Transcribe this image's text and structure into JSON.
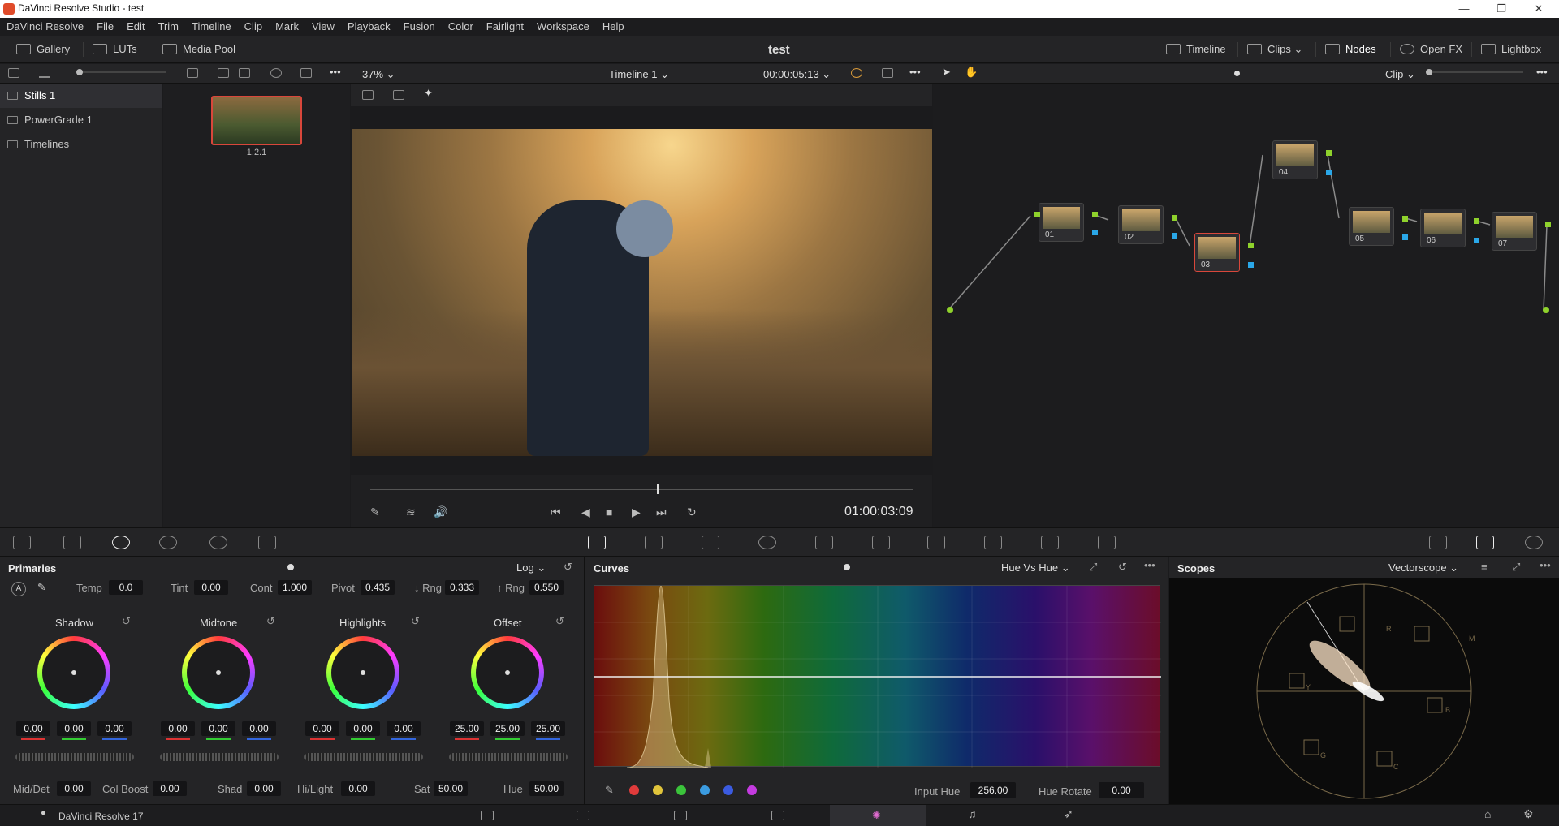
{
  "window": {
    "title": "DaVinci Resolve Studio - test"
  },
  "menu": [
    "DaVinci Resolve",
    "File",
    "Edit",
    "Trim",
    "Timeline",
    "Clip",
    "Mark",
    "View",
    "Playback",
    "Fusion",
    "Color",
    "Fairlight",
    "Workspace",
    "Help"
  ],
  "toolbar": {
    "gallery": "Gallery",
    "luts": "LUTs",
    "media_pool": "Media Pool",
    "project": "test",
    "timeline": "Timeline",
    "clips": "Clips",
    "nodes": "Nodes",
    "open_fx": "Open FX",
    "lightbox": "Lightbox"
  },
  "viewer": {
    "zoom": "37%",
    "timeline_name": "Timeline 1",
    "timecode_top": "00:00:05:13",
    "timecode_bottom": "01:00:03:09"
  },
  "node_bar": {
    "clip": "Clip"
  },
  "albums": [
    "Stills 1",
    "PowerGrade 1",
    "Timelines"
  ],
  "still": {
    "label": "1.2.1"
  },
  "nodes": [
    "01",
    "02",
    "03",
    "04",
    "05",
    "06",
    "07"
  ],
  "primaries": {
    "title": "Primaries",
    "mode": "Log",
    "fields": [
      {
        "label": "Temp",
        "value": "0.0"
      },
      {
        "label": "Tint",
        "value": "0.00"
      },
      {
        "label": "Cont",
        "value": "1.000"
      },
      {
        "label": "Pivot",
        "value": "0.435"
      },
      {
        "label": "↓ Rng",
        "value": "0.333"
      },
      {
        "label": "↑ Rng",
        "value": "0.550"
      }
    ],
    "wheels": [
      {
        "name": "Shadow",
        "values": [
          "0.00",
          "0.00",
          "0.00"
        ]
      },
      {
        "name": "Midtone",
        "values": [
          "0.00",
          "0.00",
          "0.00"
        ]
      },
      {
        "name": "Highlights",
        "values": [
          "0.00",
          "0.00",
          "0.00"
        ]
      },
      {
        "name": "Offset",
        "values": [
          "25.00",
          "25.00",
          "25.00"
        ]
      }
    ],
    "bottom": [
      {
        "label": "Mid/Det",
        "value": "0.00"
      },
      {
        "label": "Col Boost",
        "value": "0.00"
      },
      {
        "label": "Shad",
        "value": "0.00"
      },
      {
        "label": "Hi/Light",
        "value": "0.00"
      },
      {
        "label": "Sat",
        "value": "50.00"
      },
      {
        "label": "Hue",
        "value": "50.00"
      }
    ]
  },
  "curves": {
    "title": "Curves",
    "mode": "Hue Vs Hue",
    "input_hue_label": "Input Hue",
    "input_hue": "256.00",
    "hue_rotate_label": "Hue Rotate",
    "hue_rotate": "0.00",
    "swatches": [
      "#e03b3b",
      "#e0c43b",
      "#3bc43b",
      "#3b9be0",
      "#3b5be0",
      "#c43be0"
    ]
  },
  "scopes": {
    "title": "Scopes",
    "mode": "Vectorscope",
    "targets": [
      "R",
      "M",
      "B",
      "C",
      "G",
      "Y"
    ]
  },
  "status": {
    "app": "DaVinci Resolve 17"
  }
}
